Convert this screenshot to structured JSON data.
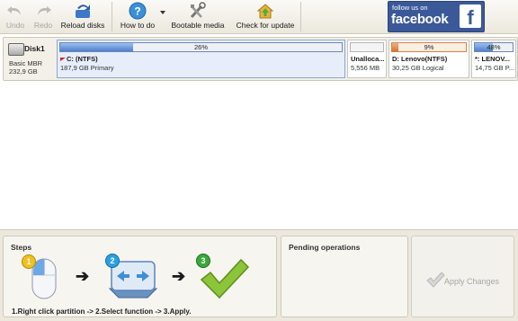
{
  "toolbar": {
    "undo_label": "Undo",
    "redo_label": "Redo",
    "reload_label": "Reload disks",
    "howto_label": "How to do",
    "bootable_label": "Bootable media",
    "update_label": "Check for update"
  },
  "facebook": {
    "follow_text": "follow us on",
    "brand_text": "facebook",
    "f_text": "f"
  },
  "disk": {
    "name": "Disk1",
    "type": "Basic MBR",
    "size": "232,9 GB",
    "partitions": [
      {
        "name": "C: (NTFS)",
        "detail": "187,9 GB Primary",
        "percent_label": "26%",
        "used_fraction": 0.26
      },
      {
        "name": "Unalloca...",
        "detail": "5,556 MB",
        "percent_label": "",
        "used_fraction": 0
      },
      {
        "name": "D: Lenovo(NTFS)",
        "detail": "30,25 GB Logical",
        "percent_label": "9%",
        "used_fraction": 0.09
      },
      {
        "name": "*: LENOV...",
        "detail": "14,75 GB P...",
        "percent_label": "48%",
        "used_fraction": 0.48
      }
    ]
  },
  "steps": {
    "title": "Steps",
    "step_numbers": [
      "1",
      "2",
      "3"
    ],
    "arrows": [
      "➔",
      "➔"
    ],
    "instruction": "1.Right click partition -> 2.Select function -> 3.Apply."
  },
  "pending": {
    "title": "Pending operations"
  },
  "apply": {
    "label": "Apply Changes"
  },
  "colors": {
    "facebook_blue": "#3b5998",
    "partition_blue": "#4f7fcc",
    "partition_orange": "#d8712f",
    "step_badge_yellow": "#f0c020",
    "step_badge_blue": "#2aa0e0",
    "step_badge_green": "#3aa83a",
    "check_green": "#8cc43a"
  }
}
